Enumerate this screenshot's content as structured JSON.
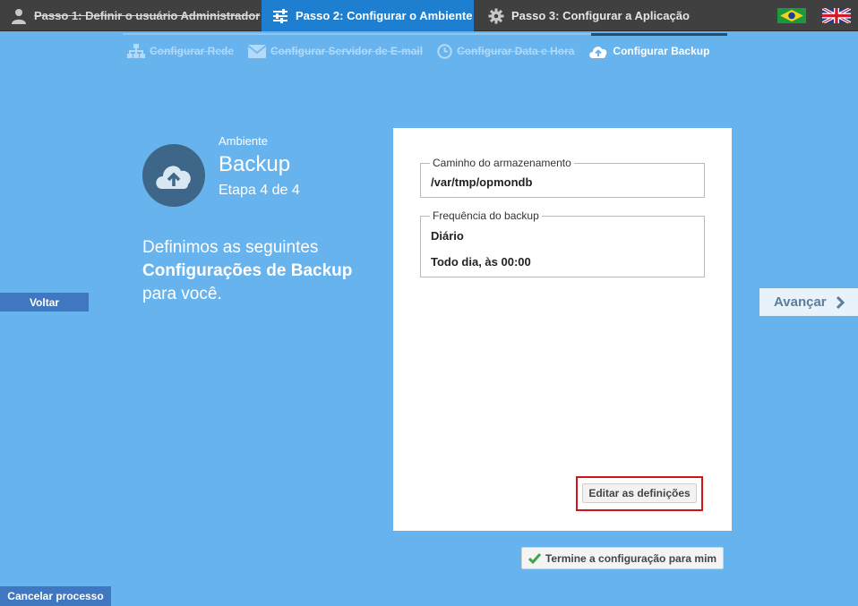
{
  "topbar": {
    "steps": [
      {
        "label": "Passo 1: Definir o usuário Administrador",
        "icon": "user-icon",
        "state": "done"
      },
      {
        "label": "Passo 2: Configurar o Ambiente",
        "icon": "sliders-icon",
        "state": "active"
      },
      {
        "label": "Passo 3: Configurar a Aplicação",
        "icon": "gear-icon",
        "state": "pending"
      }
    ],
    "flags": [
      "brazil-flag-icon",
      "uk-flag-icon"
    ],
    "active_color": "#1e7fd0"
  },
  "subnav": {
    "items": [
      {
        "label": "Configurar Rede",
        "icon": "network-icon",
        "state": "done"
      },
      {
        "label": "Configurar Servidor de E-mail",
        "icon": "envelope-icon",
        "state": "done"
      },
      {
        "label": "Configurar Data e Hora",
        "icon": "clock-icon",
        "state": "done"
      },
      {
        "label": "Configurar Backup",
        "icon": "cloud-upload-icon",
        "state": "active"
      }
    ]
  },
  "section": {
    "label": "Ambiente",
    "title": "Backup",
    "step": "Etapa 4 de 4",
    "intro_line1": "Definimos as seguintes",
    "intro_strong": "Configurações de Backup",
    "intro_line3": "para você."
  },
  "nav": {
    "back": "Voltar",
    "next": "Avançar",
    "cancel": "Cancelar processo"
  },
  "panel": {
    "storage_legend": "Caminho do armazenamento",
    "storage_value": "/var/tmp/opmondb",
    "frequency_legend": "Frequência do backup",
    "frequency_value": "Diário",
    "frequency_detail": "Todo dia, às 00:00",
    "edit_button": "Editar as definições"
  },
  "finish_button": "Termine a configuração para mim",
  "colors": {
    "background": "#67b3ee",
    "topbar": "#404040",
    "button_blue": "#3f78c0",
    "highlight_border": "#d0141a",
    "check_green": "#3ea64a"
  }
}
